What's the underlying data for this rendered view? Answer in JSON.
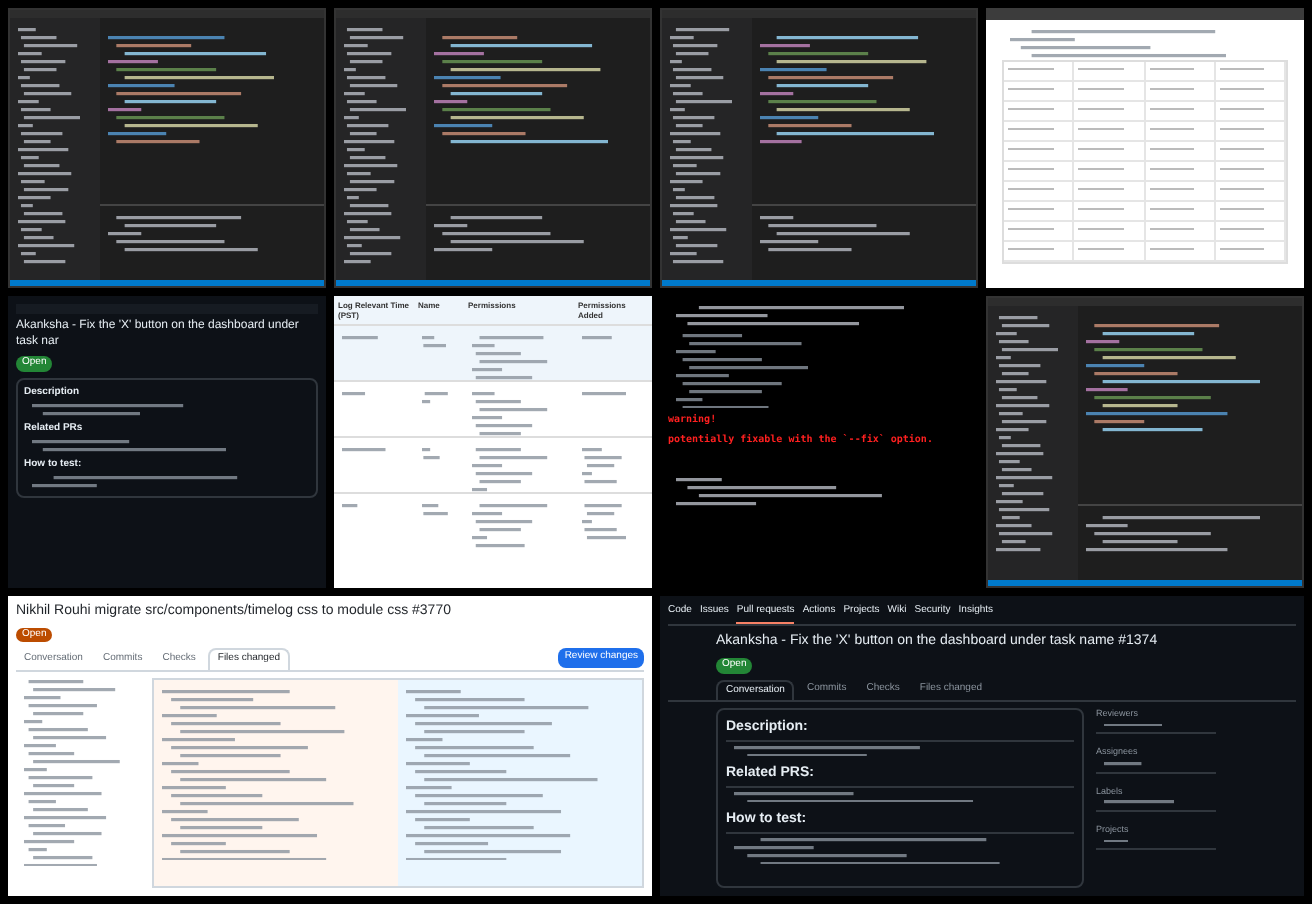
{
  "panels": [
    {
      "kind": "editor"
    },
    {
      "kind": "editor"
    },
    {
      "kind": "editor"
    },
    {
      "kind": "doc-table"
    },
    {
      "kind": "pr-dark",
      "title": "Akanksha - Fix the 'X' button on the dashboard under task nar",
      "status": "Open",
      "headings": [
        "Description",
        "Related PRs",
        "How to test:"
      ]
    },
    {
      "kind": "table",
      "columns": [
        "Log Relevant Time (PST)",
        "Name",
        "Permissions",
        "Permissions Added"
      ]
    },
    {
      "kind": "terminal",
      "lines": [
        "warning!",
        "potentially fixable with the `--fix` option."
      ]
    },
    {
      "kind": "editor"
    },
    {
      "kind": "pr-files",
      "title": "Nikhil Rouhi migrate src/components/timelog css to module css #3770",
      "status": "Open",
      "tabs": [
        {
          "label": "Conversation",
          "selected": false
        },
        {
          "label": "Commits",
          "selected": false
        },
        {
          "label": "Checks",
          "selected": false
        },
        {
          "label": "Files changed",
          "selected": true
        }
      ],
      "button": "Review changes"
    },
    {
      "kind": "pr-full",
      "nav": [
        {
          "label": "Code",
          "selected": false
        },
        {
          "label": "Issues",
          "selected": false
        },
        {
          "label": "Pull requests",
          "selected": true
        },
        {
          "label": "Actions",
          "selected": false
        },
        {
          "label": "Projects",
          "selected": false
        },
        {
          "label": "Wiki",
          "selected": false
        },
        {
          "label": "Security",
          "selected": false
        },
        {
          "label": "Insights",
          "selected": false
        }
      ],
      "title": "Akanksha - Fix the 'X' button on the dashboard under task name #1374",
      "status": "Open",
      "tabs": [
        {
          "label": "Conversation",
          "selected": true
        },
        {
          "label": "Commits",
          "selected": false
        },
        {
          "label": "Checks",
          "selected": false
        },
        {
          "label": "Files changed",
          "selected": false
        }
      ],
      "headings": [
        "Description:",
        "Related PRS:",
        "How to test:"
      ],
      "sidebar": [
        "Reviewers",
        "Assignees",
        "Labels",
        "Projects"
      ]
    }
  ]
}
